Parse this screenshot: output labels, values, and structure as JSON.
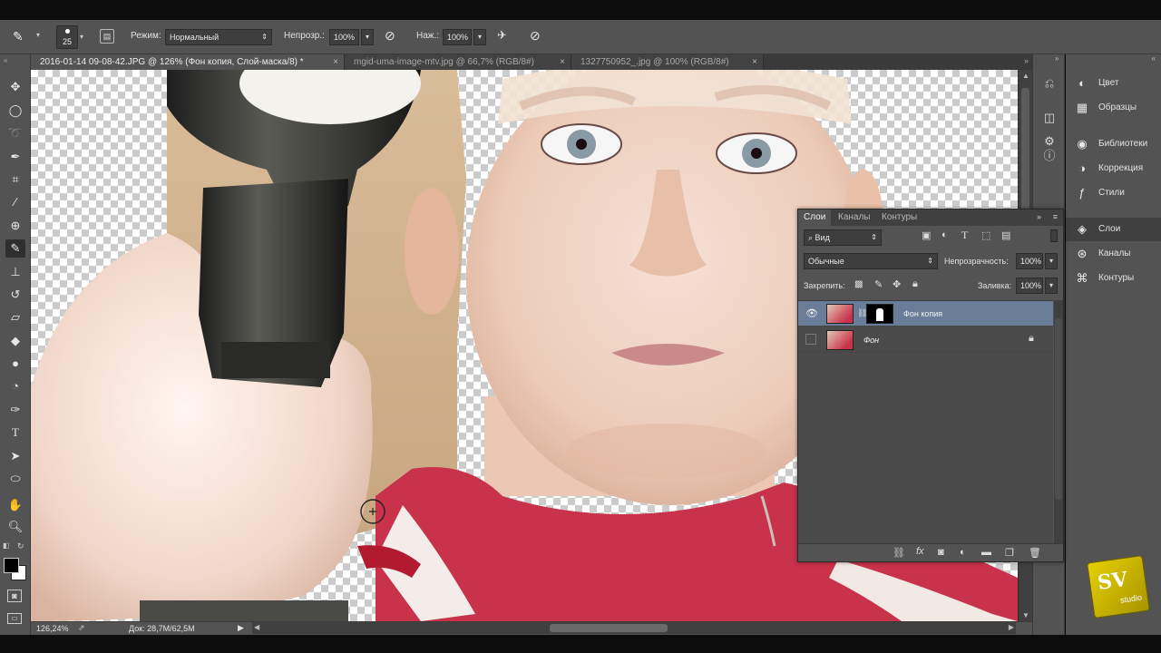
{
  "options": {
    "brush_size": "25",
    "mode_label": "Режим:",
    "mode_value": "Нормальный",
    "opacity_label": "Непрозр.:",
    "opacity_value": "100%",
    "flow_label": "Наж.:",
    "flow_value": "100%"
  },
  "tabs": [
    {
      "label": "2016-01-14 09-08-42.JPG @ 126% (Фон копия, Слой-маска/8) *",
      "close": "×"
    },
    {
      "label": "mgid-uma-image-mtv.jpg @ 66,7% (RGB/8#)",
      "close": "×"
    },
    {
      "label": "1327750952_.jpg @ 100% (RGB/8#)",
      "close": "×"
    }
  ],
  "status": {
    "zoom": "126,24%",
    "doc": "Док: 28,7M/62,5M"
  },
  "dock": [
    {
      "label": "Цвет",
      "icon": "color-wheel-icon"
    },
    {
      "label": "Образцы",
      "icon": "swatches-icon"
    },
    {
      "label": "Библиотеки",
      "icon": "libraries-icon"
    },
    {
      "label": "Коррекция",
      "icon": "adjustments-icon"
    },
    {
      "label": "Стили",
      "icon": "styles-icon"
    },
    {
      "label": "Слои",
      "icon": "layers-icon"
    },
    {
      "label": "Каналы",
      "icon": "channels-icon"
    },
    {
      "label": "Контуры",
      "icon": "paths-icon"
    }
  ],
  "layers_panel": {
    "tabs": [
      "Слои",
      "Каналы",
      "Контуры"
    ],
    "filter_value": "Вид",
    "blend_value": "Обычные",
    "opacity_label": "Непрозрачность:",
    "opacity_value": "100%",
    "lock_label": "Закрепить:",
    "fill_label": "Заливка:",
    "fill_value": "100%",
    "layers": [
      {
        "name": "Фон копия",
        "visible": true,
        "selected": true,
        "has_mask": true
      },
      {
        "name": "Фон",
        "visible": false,
        "selected": false,
        "locked": true
      }
    ]
  },
  "watermark": {
    "text_main": "SV",
    "text_sub": "studio"
  },
  "colors": {
    "ui_panel": "#535353",
    "ui_dark": "#3a3a3a",
    "selected_layer": "#6a7d98",
    "shirt_red": "#c8324a",
    "skin": "#f0d3c2",
    "watermark_gold": "#c8b400"
  }
}
